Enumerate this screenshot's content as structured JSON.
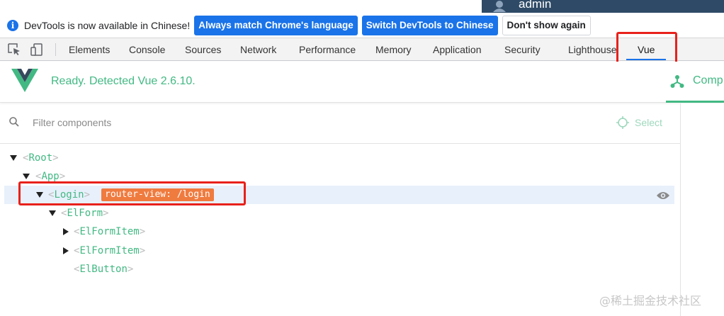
{
  "page_header": {
    "user_name": "admin"
  },
  "infobar": {
    "message": "DevTools is now available in Chinese!",
    "btn_match": "Always match Chrome's language",
    "btn_switch": "Switch DevTools to Chinese",
    "btn_dismiss": "Don't show again"
  },
  "tabs": [
    {
      "label": "Elements"
    },
    {
      "label": "Console"
    },
    {
      "label": "Sources"
    },
    {
      "label": "Network"
    },
    {
      "label": "Performance"
    },
    {
      "label": "Memory"
    },
    {
      "label": "Application"
    },
    {
      "label": "Security"
    },
    {
      "label": "Lighthouse"
    },
    {
      "label": "Vue",
      "active": true
    }
  ],
  "vue": {
    "status": "Ready. Detected Vue 2.6.10.",
    "components_tab": "Comp"
  },
  "filter": {
    "placeholder": "Filter components",
    "select_label": "Select"
  },
  "tree": [
    {
      "name": "Root",
      "expanded": true,
      "depth": 0
    },
    {
      "name": "App",
      "expanded": true,
      "depth": 1
    },
    {
      "name": "Login",
      "expanded": true,
      "depth": 2,
      "selected": true,
      "badge": "router-view: /login"
    },
    {
      "name": "ElForm",
      "expanded": true,
      "depth": 3
    },
    {
      "name": "ElFormItem",
      "expanded": false,
      "depth": 4
    },
    {
      "name": "ElFormItem",
      "expanded": false,
      "depth": 4
    },
    {
      "name": "ElButton",
      "leaf": true,
      "depth": 4
    }
  ],
  "tag_open": "<",
  "tag_close": ">",
  "watermark": "@稀土掘金技术社区",
  "colors": {
    "vue_green": "#42b983",
    "chrome_blue": "#1a73e8",
    "badge_orange": "#f07b3f",
    "highlight_red": "#e8211b"
  }
}
